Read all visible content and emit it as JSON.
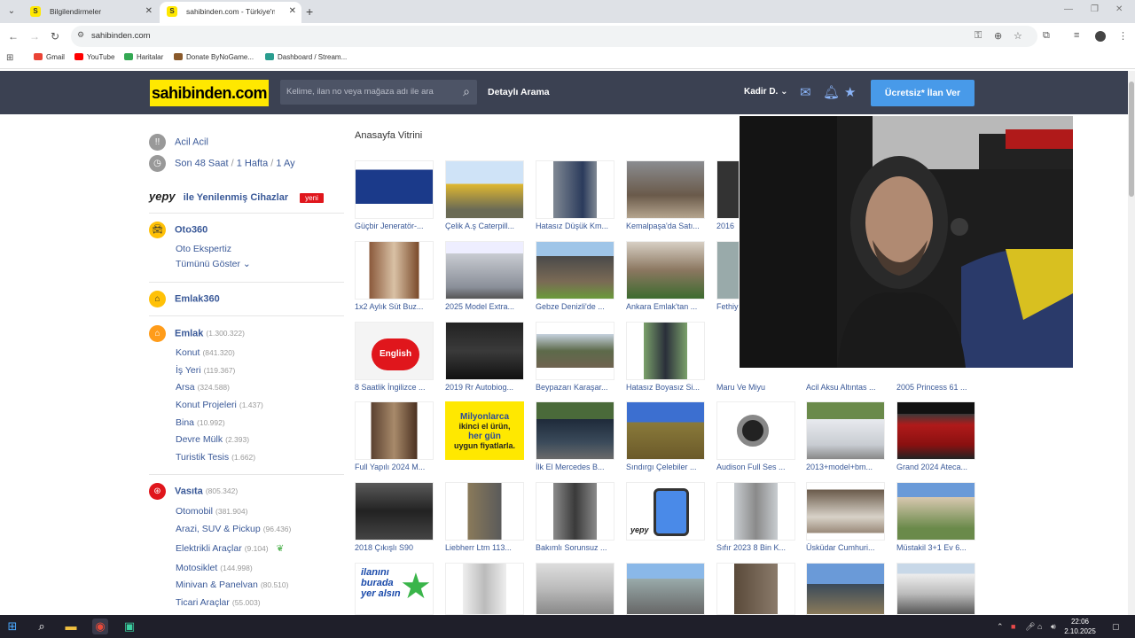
{
  "browser": {
    "tabs": [
      {
        "title": "Bilgilendirmeler",
        "favicon": "S"
      },
      {
        "title": "sahibinden.com - Türkiye'nin Ö",
        "favicon": "S"
      }
    ],
    "url": "sahibinden.com",
    "bookmarks": [
      "Gmail",
      "YouTube",
      "Haritalar",
      "Donate ByNoGame...",
      "Dashboard / Stream..."
    ]
  },
  "site": {
    "logo": "sahibinden.com",
    "search_placeholder": "Kelime, ilan no veya mağaza adı ile ara",
    "detailed_search": "Detaylı Arama",
    "user_name": "Kadir D.",
    "post_ad_button": "Ücretsiz* İlan Ver"
  },
  "sidebar": {
    "acil": "Acil Acil",
    "son48": "Son 48 Saat",
    "sep1": " / ",
    "hafta": "1 Hafta",
    "sep2": " / ",
    "ay": "1 Ay",
    "yepy_brand": "yepy",
    "yepy_text": "ile Yenilenmiş Cihazlar",
    "yeni_badge": "yeni",
    "oto360": "Oto360",
    "oto_ekspertiz": "Oto Ekspertiz",
    "tumunu_goster": "Tümünü Göster",
    "emlak360": "Emlak360",
    "emlak": {
      "label": "Emlak",
      "count": "(1.300.322)"
    },
    "emlak_items": [
      {
        "label": "Konut",
        "count": "(841.320)"
      },
      {
        "label": "İş Yeri",
        "count": "(119.367)"
      },
      {
        "label": "Arsa",
        "count": "(324.588)"
      },
      {
        "label": "Konut Projeleri",
        "count": "(1.437)"
      },
      {
        "label": "Bina",
        "count": "(10.992)"
      },
      {
        "label": "Devre Mülk",
        "count": "(2.393)"
      },
      {
        "label": "Turistik Tesis",
        "count": "(1.662)"
      }
    ],
    "vasita": {
      "label": "Vasıta",
      "count": "(805.342)"
    },
    "vasita_items": [
      {
        "label": "Otomobil",
        "count": "(381.904)"
      },
      {
        "label": "Arazi, SUV & Pickup",
        "count": "(96.436)"
      },
      {
        "label": "Elektrikli Araçlar",
        "count": "(9.104)"
      },
      {
        "label": "Motosiklet",
        "count": "(144.998)"
      },
      {
        "label": "Minivan & Panelvan",
        "count": "(80.510)"
      },
      {
        "label": "Ticari Araçlar",
        "count": "(55.003)"
      }
    ]
  },
  "vitrin": {
    "title": "Anasayfa Vitrini",
    "rows": [
      [
        "Güçbir Jeneratör-...",
        "Çelik A.ş Caterpill...",
        "Hatasız Düşük Km...",
        "Kemalpaşa'da Satı...",
        "2016"
      ],
      [
        "1x2 Aylık Süt Buz...",
        "2025 Model Extra...",
        "Gebze Denizli'de ...",
        "Ankara Emlak'tan ...",
        "Fethiy"
      ],
      [
        "8 Saatlik İngilizce ...",
        "2019 Rr Autobiog...",
        "Beypazarı Karaşar...",
        "Hatasız Boyasız Si...",
        "Maru Ve Miyu",
        "Acil Aksu Altıntas ...",
        "2005 Princess 61 ..."
      ],
      [
        "Full Yapılı 2024 M...",
        "",
        "İlk El Mercedes B...",
        "Sındırgı Çelebiler ...",
        "Audison Full Ses ...",
        "2013+model+bm...",
        "Grand 2024 Ateca..."
      ],
      [
        "2018 Çıkışlı S90",
        "Liebherr Ltm 113...",
        "Bakımlı Sorunsuz ...",
        "",
        "Sıfır 2023 8 Bin K...",
        "Üsküdar Cumhuri...",
        "Müstakil 3+1 Ev 6..."
      ]
    ],
    "promo_text_1": "Milyonlarca",
    "promo_text_2": "ikinci el ürün,",
    "promo_text_3": "her gün",
    "promo_text_4": "uygun fiyatlarla.",
    "english_label": "English",
    "ilan_label_1": "ilanını",
    "ilan_label_2": "burada",
    "ilan_label_3": "yer alsın",
    "yepy_card": "yepy"
  },
  "taskbar": {
    "time": "22:06",
    "date": "2.10.2025"
  },
  "colors": {
    "header_bg": "#3b4152",
    "logo_bg": "#ffe800",
    "link": "#3a5998",
    "accent_blue": "#489ae9",
    "badge_red": "#e0161c"
  }
}
